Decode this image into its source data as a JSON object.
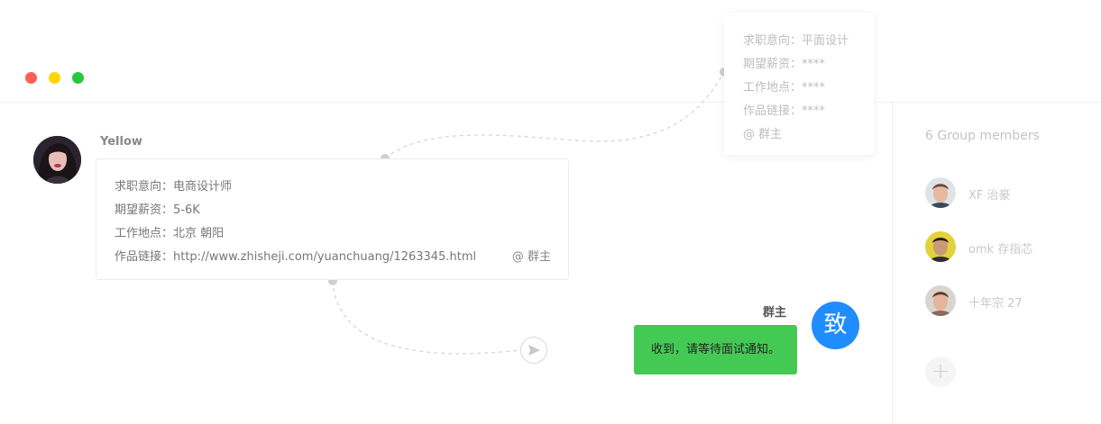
{
  "theme": {
    "red": "#ff5f57",
    "yellow": "#ffd500",
    "green": "#28c840",
    "blue": "#1f8cff",
    "bubble": "#45c955"
  },
  "float_card": {
    "line1": "求职意向：平面设计",
    "line2": "期望薪资：****",
    "line3": "工作地点：****",
    "line4": "作品链接：****",
    "mention": "@ 群主"
  },
  "message": {
    "sender": "Yellow",
    "avatar_icon": "user-avatar-photo",
    "line1": "求职意向：电商设计师",
    "line2": "期望薪资：5-6K",
    "line3": "工作地点：北京 朝阳",
    "line4": "作品链接：http://www.zhisheji.com/yuanchuang/1263345.html",
    "mention": "@ 群主",
    "send_icon": "send-icon"
  },
  "reply": {
    "sender": "群主",
    "avatar_char": "致",
    "text": "收到，请等待面试通知。"
  },
  "sidebar": {
    "title": "6 Group members",
    "members": [
      {
        "name": "XF 治豪"
      },
      {
        "name": "omk 存指芯"
      },
      {
        "name": "十年宗 27"
      }
    ],
    "add_icon": "plus-icon",
    "add_label": "+"
  }
}
